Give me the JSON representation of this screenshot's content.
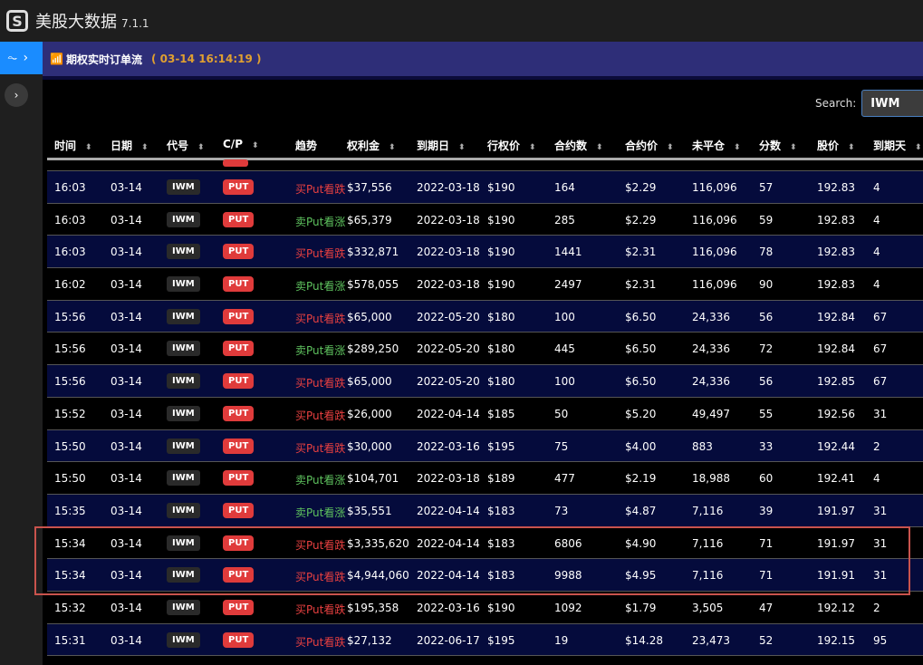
{
  "app": {
    "title": "美股大数据",
    "version": "7.1.1"
  },
  "banner": {
    "title": "期权实时订单流",
    "timestamp": "( 03-14 16:14:19 )"
  },
  "search": {
    "label": "Search:",
    "value": "IWM"
  },
  "columns": [
    "时间",
    "日期",
    "代号",
    "C/P",
    "趋势",
    "权利金",
    "到期日",
    "行权价",
    "合约数",
    "合约价",
    "未平仓",
    "分数",
    "股价",
    "到期天"
  ],
  "colors": {
    "buy": "#e84040",
    "sell": "#5ec25e",
    "highlight": "#c9534d",
    "banner": "#2e2e78"
  },
  "rows": [
    [
      "16:03",
      "03-14",
      "IWM",
      "PUT",
      "买Put看跌",
      "$37,556",
      "2022-03-18",
      "$190",
      "164",
      "$2.29",
      "116,096",
      "57",
      "192.83",
      "4"
    ],
    [
      "16:03",
      "03-14",
      "IWM",
      "PUT",
      "卖Put看涨",
      "$65,379",
      "2022-03-18",
      "$190",
      "285",
      "$2.29",
      "116,096",
      "59",
      "192.83",
      "4"
    ],
    [
      "16:03",
      "03-14",
      "IWM",
      "PUT",
      "买Put看跌",
      "$332,871",
      "2022-03-18",
      "$190",
      "1441",
      "$2.31",
      "116,096",
      "78",
      "192.83",
      "4"
    ],
    [
      "16:02",
      "03-14",
      "IWM",
      "PUT",
      "卖Put看涨",
      "$578,055",
      "2022-03-18",
      "$190",
      "2497",
      "$2.31",
      "116,096",
      "90",
      "192.83",
      "4"
    ],
    [
      "15:56",
      "03-14",
      "IWM",
      "PUT",
      "买Put看跌",
      "$65,000",
      "2022-05-20",
      "$180",
      "100",
      "$6.50",
      "24,336",
      "56",
      "192.84",
      "67"
    ],
    [
      "15:56",
      "03-14",
      "IWM",
      "PUT",
      "卖Put看涨",
      "$289,250",
      "2022-05-20",
      "$180",
      "445",
      "$6.50",
      "24,336",
      "72",
      "192.84",
      "67"
    ],
    [
      "15:56",
      "03-14",
      "IWM",
      "PUT",
      "买Put看跌",
      "$65,000",
      "2022-05-20",
      "$180",
      "100",
      "$6.50",
      "24,336",
      "56",
      "192.85",
      "67"
    ],
    [
      "15:52",
      "03-14",
      "IWM",
      "PUT",
      "买Put看跌",
      "$26,000",
      "2022-04-14",
      "$185",
      "50",
      "$5.20",
      "49,497",
      "55",
      "192.56",
      "31"
    ],
    [
      "15:50",
      "03-14",
      "IWM",
      "PUT",
      "买Put看跌",
      "$30,000",
      "2022-03-16",
      "$195",
      "75",
      "$4.00",
      "883",
      "33",
      "192.44",
      "2"
    ],
    [
      "15:50",
      "03-14",
      "IWM",
      "PUT",
      "卖Put看涨",
      "$104,701",
      "2022-03-18",
      "$189",
      "477",
      "$2.19",
      "18,988",
      "60",
      "192.41",
      "4"
    ],
    [
      "15:35",
      "03-14",
      "IWM",
      "PUT",
      "卖Put看涨",
      "$35,551",
      "2022-04-14",
      "$183",
      "73",
      "$4.87",
      "7,116",
      "39",
      "191.97",
      "31"
    ],
    [
      "15:34",
      "03-14",
      "IWM",
      "PUT",
      "买Put看跌",
      "$3,335,620",
      "2022-04-14",
      "$183",
      "6806",
      "$4.90",
      "7,116",
      "71",
      "191.97",
      "31"
    ],
    [
      "15:34",
      "03-14",
      "IWM",
      "PUT",
      "买Put看跌",
      "$4,944,060",
      "2022-04-14",
      "$183",
      "9988",
      "$4.95",
      "7,116",
      "71",
      "191.91",
      "31"
    ],
    [
      "15:32",
      "03-14",
      "IWM",
      "PUT",
      "买Put看跌",
      "$195,358",
      "2022-03-16",
      "$190",
      "1092",
      "$1.79",
      "3,505",
      "47",
      "192.12",
      "2"
    ],
    [
      "15:31",
      "03-14",
      "IWM",
      "PUT",
      "买Put看跌",
      "$27,132",
      "2022-06-17",
      "$195",
      "19",
      "$14.28",
      "23,473",
      "52",
      "192.15",
      "95"
    ]
  ]
}
